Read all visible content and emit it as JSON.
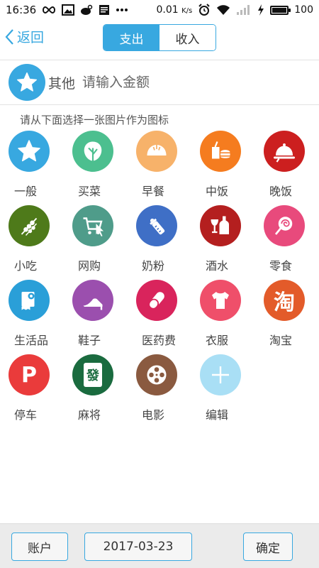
{
  "status_bar": {
    "time": "16:36",
    "speed": "0.01",
    "speed_unit": "K/s",
    "battery_level": 100,
    "battery_text": "100",
    "icons": [
      "infinity-icon",
      "image-icon",
      "weibo-icon",
      "news-icon",
      "more-dots-icon",
      "alarm-icon",
      "wifi-icon",
      "signal-icon",
      "charging-icon"
    ]
  },
  "header": {
    "back_label": "返回",
    "tabs": [
      {
        "label": "支出",
        "active": true
      },
      {
        "label": "收入",
        "active": false
      }
    ]
  },
  "amount": {
    "category": "其他",
    "placeholder": "请输入金额",
    "icon": "star-icon"
  },
  "hint": "请从下面选择一张图片作为图标",
  "categories": [
    {
      "label": "一般",
      "icon": "star-icon",
      "color": "#38a8e0"
    },
    {
      "label": "买菜",
      "icon": "cabbage-icon",
      "color": "#4cbf8f"
    },
    {
      "label": "早餐",
      "icon": "bun-icon",
      "color": "#f7b26a"
    },
    {
      "label": "中饭",
      "icon": "fastfood-icon",
      "color": "#f57c1f"
    },
    {
      "label": "晚饭",
      "icon": "dinner-cloche-icon",
      "color": "#cc1f1f"
    },
    {
      "label": "小吃",
      "icon": "skewer-icon",
      "color": "#4e7a1a"
    },
    {
      "label": "网购",
      "icon": "shopping-cart-icon",
      "color": "#4f9c8a"
    },
    {
      "label": "奶粉",
      "icon": "baby-bottle-icon",
      "color": "#3f6fc6"
    },
    {
      "label": "酒水",
      "icon": "wine-icon",
      "color": "#b41f1f"
    },
    {
      "label": "零食",
      "icon": "lollipop-icon",
      "color": "#e84a7c"
    },
    {
      "label": "生活品",
      "icon": "toilet-paper-icon",
      "color": "#2a9fd8"
    },
    {
      "label": "鞋子",
      "icon": "high-heel-icon",
      "color": "#9b4fae"
    },
    {
      "label": "医药费",
      "icon": "pill-icon",
      "color": "#d9245c"
    },
    {
      "label": "衣服",
      "icon": "shirt-icon",
      "color": "#ef4f6a"
    },
    {
      "label": "淘宝",
      "icon": "taobao-icon",
      "color": "#e35b2a",
      "glyph": "淘"
    },
    {
      "label": "停车",
      "icon": "parking-icon",
      "color": "#ea3b3b",
      "glyph": "P"
    },
    {
      "label": "麻将",
      "icon": "mahjong-icon",
      "color": "#1a6b3f",
      "glyph": "發"
    },
    {
      "label": "电影",
      "icon": "film-reel-icon",
      "color": "#8a5a40"
    },
    {
      "label": "编辑",
      "icon": "plus-icon",
      "color": "#a9dff5"
    }
  ],
  "bottom": {
    "account_label": "账户",
    "date": "2017-03-23",
    "confirm_label": "确定"
  }
}
